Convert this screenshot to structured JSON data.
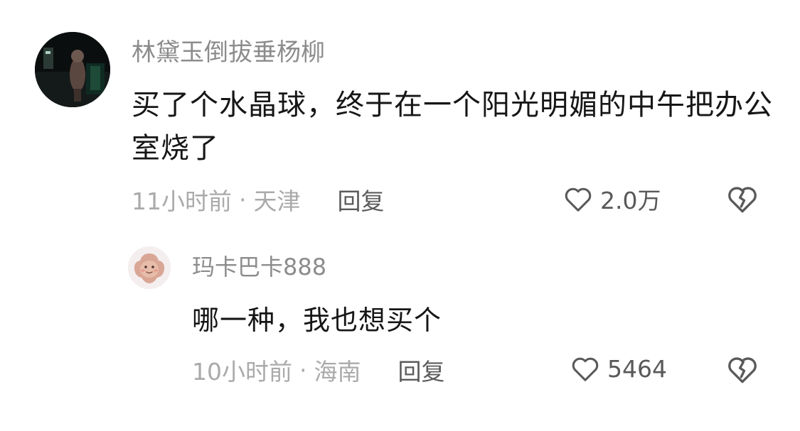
{
  "comments": [
    {
      "username": "林黛玉倒拔垂杨柳",
      "text": "买了个水晶球，终于在一个阳光明媚的中午把办公室烧了",
      "time": "11小时前",
      "separator": "·",
      "location": "天津",
      "reply_label": "回复",
      "likes": "2.0万"
    }
  ],
  "replies": [
    {
      "username": "玛卡巴卡888",
      "text": "哪一种，我也想买个",
      "time": "10小时前",
      "separator": "·",
      "location": "海南",
      "reply_label": "回复",
      "likes": "5464"
    }
  ],
  "icons": {
    "like": "heart-outline-icon",
    "dislike": "broken-heart-icon"
  },
  "colors": {
    "background": "#ffffff",
    "username": "#8c8c8c",
    "comment_text": "#161616",
    "meta": "#aaaaaa",
    "action": "#595959"
  }
}
